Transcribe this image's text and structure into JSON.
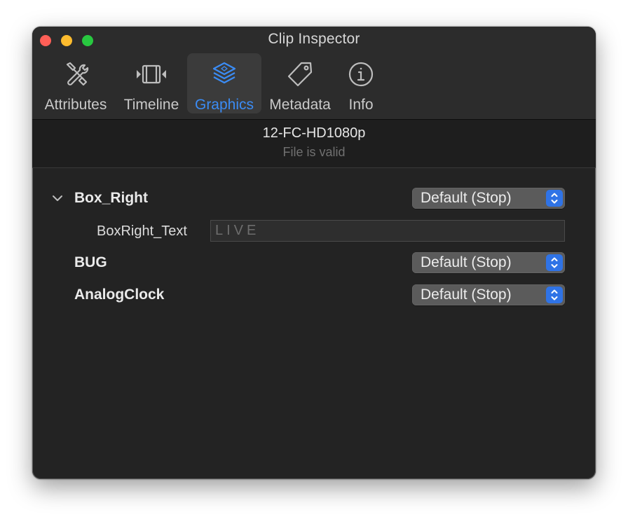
{
  "window": {
    "title": "Clip Inspector"
  },
  "tabs": [
    {
      "label": "Attributes",
      "icon": "tools-icon",
      "selected": false
    },
    {
      "label": "Timeline",
      "icon": "film-strip-icon",
      "selected": false
    },
    {
      "label": "Graphics",
      "icon": "layers-icon",
      "selected": true
    },
    {
      "label": "Metadata",
      "icon": "tag-icon",
      "selected": false
    },
    {
      "label": "Info",
      "icon": "info-icon",
      "selected": false
    }
  ],
  "clip": {
    "name": "12-FC-HD1080p",
    "status": "File is valid"
  },
  "graphics": [
    {
      "name": "Box_Right",
      "expanded": true,
      "action": "Default (Stop)",
      "fields": [
        {
          "label": "BoxRight_Text",
          "value": "LIVE"
        }
      ]
    },
    {
      "name": "BUG",
      "action": "Default (Stop)"
    },
    {
      "name": "AnalogClock",
      "action": "Default (Stop)"
    }
  ],
  "colors": {
    "accent": "#3b8cf5",
    "background": "#232323",
    "toolbar": "#2c2c2c"
  }
}
